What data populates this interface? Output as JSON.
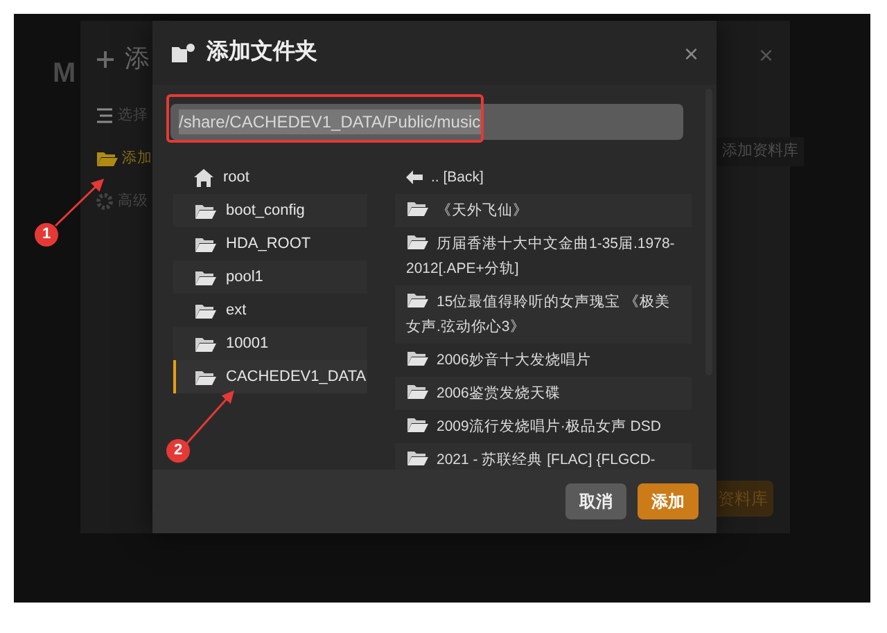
{
  "background_page": {
    "heading_fragment": "M"
  },
  "back_dialog": {
    "title": "添",
    "close": "×",
    "nav_items": [
      {
        "kind": "list",
        "label": "选择",
        "selected": false
      },
      {
        "kind": "folder",
        "label": "添加",
        "selected": true
      },
      {
        "kind": "gear",
        "label": "高级",
        "selected": false
      }
    ],
    "side_label": "添加资料库",
    "primary_button": "资料库"
  },
  "dialog": {
    "title": "添加文件夹",
    "close": "×",
    "path": {
      "value": "/share/CACHEDEV1_DATA/Public/music"
    },
    "roots": [
      {
        "kind": "home",
        "label": "root",
        "selected": false
      },
      {
        "kind": "folder",
        "label": "boot_config",
        "selected": false
      },
      {
        "kind": "folder",
        "label": "HDA_ROOT",
        "selected": false
      },
      {
        "kind": "folder",
        "label": "pool1",
        "selected": false
      },
      {
        "kind": "folder",
        "label": "ext",
        "selected": false
      },
      {
        "kind": "folder",
        "label": "10001",
        "selected": false
      },
      {
        "kind": "folder",
        "label": "CACHEDEV1_DATA",
        "selected": true
      }
    ],
    "entries": [
      {
        "kind": "back",
        "label": ".. [Back]"
      },
      {
        "kind": "folder",
        "label": "《天外飞仙》"
      },
      {
        "kind": "folder",
        "label": "历届香港十大中文金曲1-35届.1978-2012[.APE+分轨]"
      },
      {
        "kind": "folder",
        "label": "15位最值得聆听的女声瑰宝 《极美女声.弦动你心3》"
      },
      {
        "kind": "folder",
        "label": "2006妙音十大发烧唱片"
      },
      {
        "kind": "folder",
        "label": "2006鉴赏发烧天碟"
      },
      {
        "kind": "folder",
        "label": "2009流行发烧唱片·极品女声 DSD"
      },
      {
        "kind": "folder",
        "label": "2021 - 苏联经典 [FLAC] {FLGCD-"
      }
    ],
    "buttons": [
      {
        "kind": "secondary",
        "label": "取消"
      },
      {
        "kind": "primary",
        "label": "添加"
      }
    ]
  },
  "annotations": [
    {
      "label": "1"
    },
    {
      "label": "2"
    }
  ]
}
